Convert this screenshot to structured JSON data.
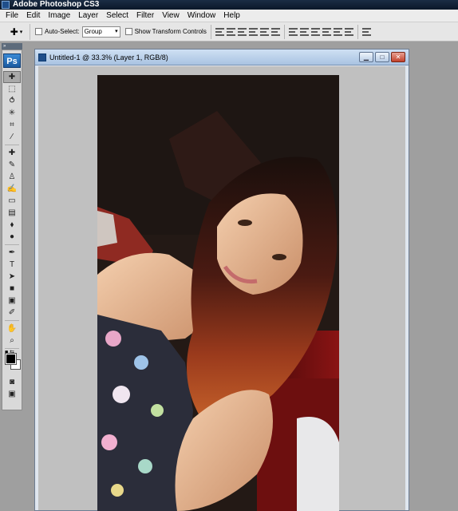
{
  "app": {
    "title": "Adobe Photoshop CS3"
  },
  "menu": {
    "items": [
      "File",
      "Edit",
      "Image",
      "Layer",
      "Select",
      "Filter",
      "View",
      "Window",
      "Help"
    ]
  },
  "options": {
    "auto_select_label": "Auto-Select:",
    "auto_select_value": "Group",
    "show_transform_label": "Show Transform Controls"
  },
  "tools": {
    "logo": "Ps",
    "items": [
      {
        "icon": "move-icon",
        "glyph": "✚",
        "selected": true
      },
      {
        "icon": "marquee-icon",
        "glyph": "⬚"
      },
      {
        "icon": "lasso-icon",
        "glyph": "⥀"
      },
      {
        "icon": "magic-wand-icon",
        "glyph": "✳"
      },
      {
        "icon": "crop-icon",
        "glyph": "⌗"
      },
      {
        "icon": "slice-icon",
        "glyph": "∕"
      },
      {
        "icon": "healing-brush-icon",
        "glyph": "✚"
      },
      {
        "icon": "brush-icon",
        "glyph": "✎"
      },
      {
        "icon": "clone-stamp-icon",
        "glyph": "♙"
      },
      {
        "icon": "history-brush-icon",
        "glyph": "✍"
      },
      {
        "icon": "eraser-icon",
        "glyph": "▭"
      },
      {
        "icon": "gradient-icon",
        "glyph": "▤"
      },
      {
        "icon": "blur-icon",
        "glyph": "⬧"
      },
      {
        "icon": "dodge-icon",
        "glyph": "●"
      },
      {
        "icon": "pen-icon",
        "glyph": "✒"
      },
      {
        "icon": "type-icon",
        "glyph": "T"
      },
      {
        "icon": "path-selection-icon",
        "glyph": "➤"
      },
      {
        "icon": "shape-icon",
        "glyph": "■"
      },
      {
        "icon": "notes-icon",
        "glyph": "▣"
      },
      {
        "icon": "eyedropper-icon",
        "glyph": "✐"
      },
      {
        "icon": "hand-icon",
        "glyph": "✋"
      },
      {
        "icon": "zoom-icon",
        "glyph": "⌕"
      }
    ],
    "foreground_color": "#000000",
    "background_color": "#ffffff"
  },
  "document": {
    "title": "Untitled-1 @ 33.3% (Layer 1, RGB/8)"
  },
  "colors": {
    "canvas_bg": "#c0c0c0",
    "workspace_bg": "#9f9f9f"
  }
}
